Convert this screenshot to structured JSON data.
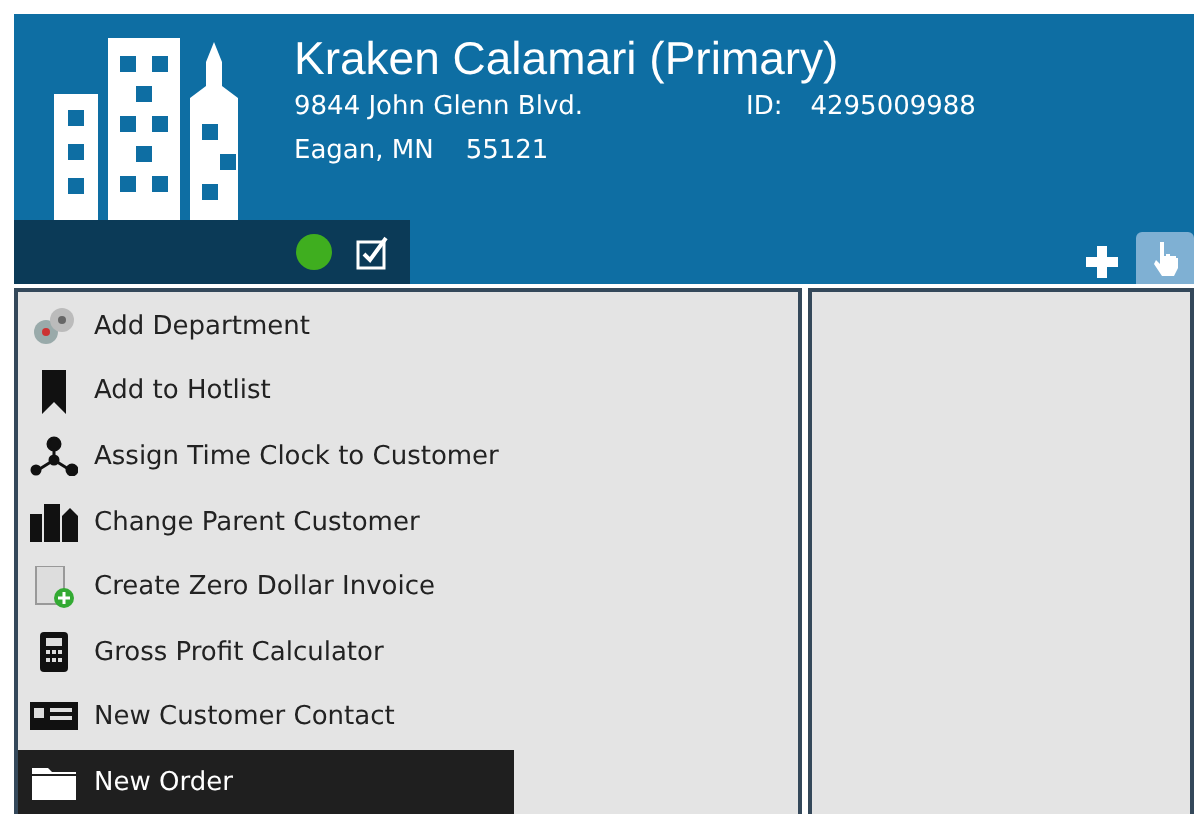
{
  "customer": {
    "name": "Kraken Calamari (Primary)",
    "address_line_1": "9844 John Glenn Blvd.",
    "city": "Eagan, MN",
    "zip": "55121",
    "id_label": "ID:",
    "id_value": "4295009988"
  },
  "indicators": [
    {
      "kind": "status",
      "color": "#3fae1f"
    },
    {
      "kind": "checkbox",
      "checked": true
    }
  ],
  "toolbar": [
    {
      "kind": "add",
      "selected": false
    },
    {
      "kind": "pointer",
      "selected": true
    }
  ],
  "actions": [
    {
      "kind": "department",
      "label": "Add Department",
      "selected": false
    },
    {
      "kind": "bookmark",
      "label": "Add to Hotlist",
      "selected": false
    },
    {
      "kind": "network",
      "label": "Assign Time Clock to Customer",
      "selected": false
    },
    {
      "kind": "buildings",
      "label": "Change Parent Customer",
      "selected": false
    },
    {
      "kind": "invoice",
      "label": "Create Zero Dollar Invoice",
      "selected": false
    },
    {
      "kind": "calculator",
      "label": "Gross Profit Calculator",
      "selected": false
    },
    {
      "kind": "contact",
      "label": "New Customer Contact",
      "selected": false
    },
    {
      "kind": "folder",
      "label": "New Order",
      "selected": true
    }
  ]
}
